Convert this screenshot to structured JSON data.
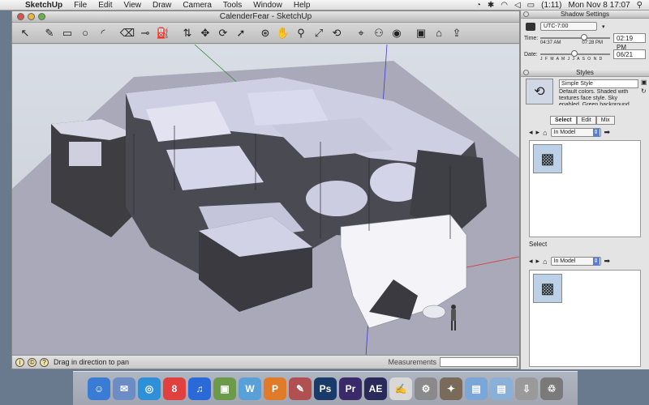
{
  "menubar": {
    "app_name": "SketchUp",
    "items": [
      "File",
      "Edit",
      "View",
      "Draw",
      "Camera",
      "Tools",
      "Window",
      "Help"
    ],
    "battery": "(1:11)",
    "clock": "Mon Nov 8  17:07"
  },
  "window": {
    "title": "CalenderFear - SketchUp"
  },
  "toolbar": {
    "tools": [
      {
        "icon": "select-arrow-icon",
        "glyph": "↖"
      },
      {
        "icon": "pencil-icon",
        "glyph": "✎"
      },
      {
        "icon": "rectangle-icon",
        "glyph": "▭"
      },
      {
        "icon": "circle-icon",
        "glyph": "○"
      },
      {
        "icon": "arc-icon",
        "glyph": "◜"
      },
      {
        "icon": "eraser-icon",
        "glyph": "⌫"
      },
      {
        "icon": "tape-measure-icon",
        "glyph": "⊸"
      },
      {
        "icon": "paint-bucket-icon",
        "glyph": "⛽"
      },
      {
        "icon": "push-pull-icon",
        "glyph": "⇅"
      },
      {
        "icon": "move-icon",
        "glyph": "✥"
      },
      {
        "icon": "rotate-icon",
        "glyph": "⟳"
      },
      {
        "icon": "follow-me-icon",
        "glyph": "➚"
      },
      {
        "icon": "orbit-icon",
        "glyph": "⊛"
      },
      {
        "icon": "pan-hand-icon",
        "glyph": "✋"
      },
      {
        "icon": "zoom-icon",
        "glyph": "⚲"
      },
      {
        "icon": "zoom-extents-icon",
        "glyph": "⤢"
      },
      {
        "icon": "previous-view-icon",
        "glyph": "⟲"
      },
      {
        "icon": "position-camera-icon",
        "glyph": "⌖"
      },
      {
        "icon": "walk-icon",
        "glyph": "⚇"
      },
      {
        "icon": "look-around-icon",
        "glyph": "◉"
      },
      {
        "icon": "components-icon",
        "glyph": "▣"
      },
      {
        "icon": "3d-warehouse-icon",
        "glyph": "⌂"
      },
      {
        "icon": "share-model-icon",
        "glyph": "⇪"
      }
    ]
  },
  "status": {
    "message": "Drag in direction to pan",
    "measurements_label": "Measurements",
    "measurements_value": ""
  },
  "shadow_settings": {
    "title": "Shadow Settings",
    "timezone": "UTC-7:00",
    "time_label": "Time:",
    "time_start": "04:37 AM",
    "time_end": "07:28 PM",
    "time_value": "02:19 PM",
    "date_label": "Date:",
    "months": "J F M A M J J A S O N D",
    "date_value": "06/21"
  },
  "styles": {
    "title": "Styles",
    "style_name": "Simple Style",
    "description": "Default colors.  Shaded with textures face style.  Sky enabled.  Green background",
    "tabs": [
      "Select",
      "Edit",
      "Mix"
    ],
    "dropdown": "In Model",
    "select_label": "Select",
    "dropdown2": "In Model"
  },
  "dock": {
    "icons": [
      {
        "name": "finder-icon",
        "label": "☺",
        "color": "#3a7bd5"
      },
      {
        "name": "preview-icon",
        "label": "✉",
        "color": "#6b8cc4"
      },
      {
        "name": "safari-icon",
        "label": "◎",
        "color": "#2f8fd8"
      },
      {
        "name": "ical-icon",
        "label": "8",
        "color": "#e04040"
      },
      {
        "name": "itunes-icon",
        "label": "♫",
        "color": "#2a6ad8"
      },
      {
        "name": "iphoto-icon",
        "label": "▣",
        "color": "#6a9a4a"
      },
      {
        "name": "wordpress-icon",
        "label": "W",
        "color": "#5aa0d8"
      },
      {
        "name": "powerpoint-icon",
        "label": "P",
        "color": "#e07b2a"
      },
      {
        "name": "pencil-app-icon",
        "label": "✎",
        "color": "#b05050"
      },
      {
        "name": "photoshop-icon",
        "label": "Ps",
        "color": "#1a3a6a"
      },
      {
        "name": "premiere-icon",
        "label": "Pr",
        "color": "#3a2a6a"
      },
      {
        "name": "after-effects-icon",
        "label": "AE",
        "color": "#2a2a5a"
      },
      {
        "name": "textedit-icon",
        "label": "✍",
        "color": "#d8d8d8"
      },
      {
        "name": "system-prefs-icon",
        "label": "⚙",
        "color": "#8a8a8a"
      },
      {
        "name": "automator-icon",
        "label": "✦",
        "color": "#7a6a5a"
      },
      {
        "name": "applications-folder-icon",
        "label": "▤",
        "color": "#7aa6d8"
      },
      {
        "name": "documents-folder-icon",
        "label": "▤",
        "color": "#8ab0d8"
      },
      {
        "name": "downloads-icon",
        "label": "⇩",
        "color": "#9a9a9a"
      },
      {
        "name": "trash-icon",
        "label": "♲",
        "color": "#7a7a7a"
      }
    ]
  }
}
